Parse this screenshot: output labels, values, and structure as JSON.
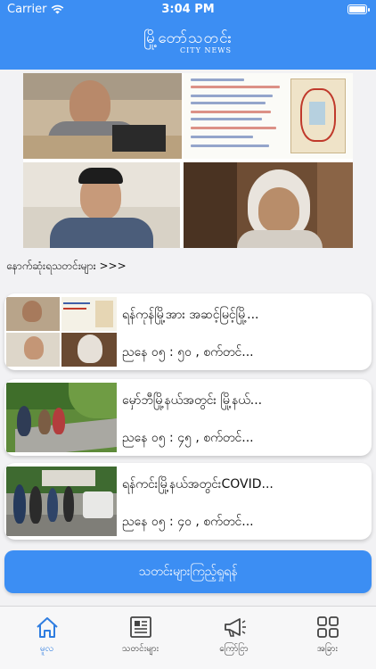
{
  "status_bar": {
    "carrier": "Carrier",
    "time": "3:04 PM"
  },
  "header": {
    "logo_mm": "မြို့တော်သတင်း",
    "logo_en": "CITY NEWS",
    "color": "#3c8ef3"
  },
  "latest_link": "နောက်ဆုံးရသတင်းများ >>>",
  "news": [
    {
      "title": "ရန်ကုန်မြို့အား အဆင့်မြင့်မြို့...",
      "date": "ညနေ ၀၅ : ၅၀ , စက်တင်..."
    },
    {
      "title": "မှော်ဘီမြို့နယ်အတွင်း မြို့နယ်...",
      "date": "ညနေ ၀၅ : ၄၅ , စက်တင်..."
    },
    {
      "title": "ရန်ကင်းမြို့နယ်အတွင်းCOVID...",
      "date": "ညနေ ၀၅ : ၄၀ , စက်တင်..."
    }
  ],
  "cta_label": "သတင်းများကြည့်ရှုရန်",
  "tabs": [
    {
      "label": "မူလ",
      "icon": "home-icon"
    },
    {
      "label": "သတင်းများ",
      "icon": "newspaper-icon"
    },
    {
      "label": "ကြော်ငြာ",
      "icon": "megaphone-icon"
    },
    {
      "label": "အခြား",
      "icon": "grid-icon"
    }
  ]
}
